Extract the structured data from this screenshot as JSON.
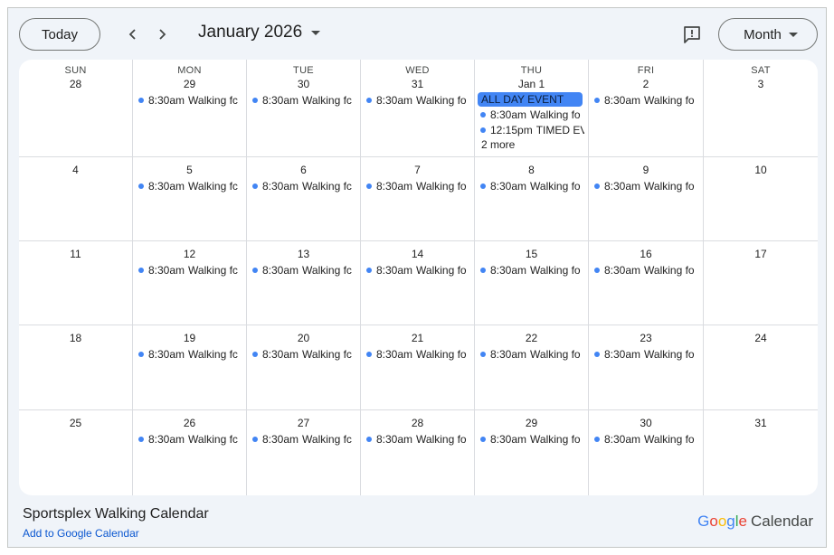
{
  "toolbar": {
    "today_label": "Today",
    "month_title": "January 2026",
    "view_label": "Month",
    "icons": {
      "prev": "chevron-left-icon",
      "next": "chevron-right-icon",
      "feedback": "feedback-icon",
      "dropdown": "caret-down-icon"
    }
  },
  "day_headers": [
    "SUN",
    "MON",
    "TUE",
    "WED",
    "THU",
    "FRI",
    "SAT"
  ],
  "weeks": [
    {
      "days": [
        {
          "label": "28",
          "events": []
        },
        {
          "label": "29",
          "events": [
            {
              "time": "8:30am",
              "title": "Walking fc"
            }
          ]
        },
        {
          "label": "30",
          "events": [
            {
              "time": "8:30am",
              "title": "Walking fc"
            }
          ]
        },
        {
          "label": "31",
          "events": [
            {
              "time": "8:30am",
              "title": "Walking fo"
            }
          ]
        },
        {
          "label": "Jan 1",
          "all_day": "ALL DAY EVENT",
          "events": [
            {
              "time": "8:30am",
              "title": "Walking fo"
            },
            {
              "time": "12:15pm",
              "title": "TIMED EV"
            }
          ],
          "more": "2 more"
        },
        {
          "label": "2",
          "events": [
            {
              "time": "8:30am",
              "title": "Walking fo"
            }
          ]
        },
        {
          "label": "3",
          "events": []
        }
      ]
    },
    {
      "days": [
        {
          "label": "4",
          "events": []
        },
        {
          "label": "5",
          "events": [
            {
              "time": "8:30am",
              "title": "Walking fc"
            }
          ]
        },
        {
          "label": "6",
          "events": [
            {
              "time": "8:30am",
              "title": "Walking fc"
            }
          ]
        },
        {
          "label": "7",
          "events": [
            {
              "time": "8:30am",
              "title": "Walking fo"
            }
          ]
        },
        {
          "label": "8",
          "events": [
            {
              "time": "8:30am",
              "title": "Walking fo"
            }
          ]
        },
        {
          "label": "9",
          "events": [
            {
              "time": "8:30am",
              "title": "Walking fo"
            }
          ]
        },
        {
          "label": "10",
          "events": []
        }
      ]
    },
    {
      "days": [
        {
          "label": "11",
          "events": []
        },
        {
          "label": "12",
          "events": [
            {
              "time": "8:30am",
              "title": "Walking fc"
            }
          ]
        },
        {
          "label": "13",
          "events": [
            {
              "time": "8:30am",
              "title": "Walking fc"
            }
          ]
        },
        {
          "label": "14",
          "events": [
            {
              "time": "8:30am",
              "title": "Walking fo"
            }
          ]
        },
        {
          "label": "15",
          "events": [
            {
              "time": "8:30am",
              "title": "Walking fo"
            }
          ]
        },
        {
          "label": "16",
          "events": [
            {
              "time": "8:30am",
              "title": "Walking fo"
            }
          ]
        },
        {
          "label": "17",
          "events": []
        }
      ]
    },
    {
      "days": [
        {
          "label": "18",
          "events": []
        },
        {
          "label": "19",
          "events": [
            {
              "time": "8:30am",
              "title": "Walking fc"
            }
          ]
        },
        {
          "label": "20",
          "events": [
            {
              "time": "8:30am",
              "title": "Walking fc"
            }
          ]
        },
        {
          "label": "21",
          "events": [
            {
              "time": "8:30am",
              "title": "Walking fo"
            }
          ]
        },
        {
          "label": "22",
          "events": [
            {
              "time": "8:30am",
              "title": "Walking fo"
            }
          ]
        },
        {
          "label": "23",
          "events": [
            {
              "time": "8:30am",
              "title": "Walking fo"
            }
          ]
        },
        {
          "label": "24",
          "events": []
        }
      ]
    },
    {
      "days": [
        {
          "label": "25",
          "events": []
        },
        {
          "label": "26",
          "events": [
            {
              "time": "8:30am",
              "title": "Walking fc"
            }
          ]
        },
        {
          "label": "27",
          "events": [
            {
              "time": "8:30am",
              "title": "Walking fc"
            }
          ]
        },
        {
          "label": "28",
          "events": [
            {
              "time": "8:30am",
              "title": "Walking fo"
            }
          ]
        },
        {
          "label": "29",
          "events": [
            {
              "time": "8:30am",
              "title": "Walking fo"
            }
          ]
        },
        {
          "label": "30",
          "events": [
            {
              "time": "8:30am",
              "title": "Walking fo"
            }
          ]
        },
        {
          "label": "31",
          "events": []
        }
      ]
    }
  ],
  "footer": {
    "calendar_name": "Sportsplex Walking Calendar",
    "add_link": "Add to Google Calendar",
    "logo": {
      "letters": [
        "G",
        "o",
        "o",
        "g",
        "l",
        "e"
      ],
      "product": "Calendar"
    }
  },
  "colors": {
    "event_dot": "#4285f4",
    "all_day_bg": "#4285f4",
    "link": "#0b57d0",
    "background": "#f0f4f9"
  }
}
